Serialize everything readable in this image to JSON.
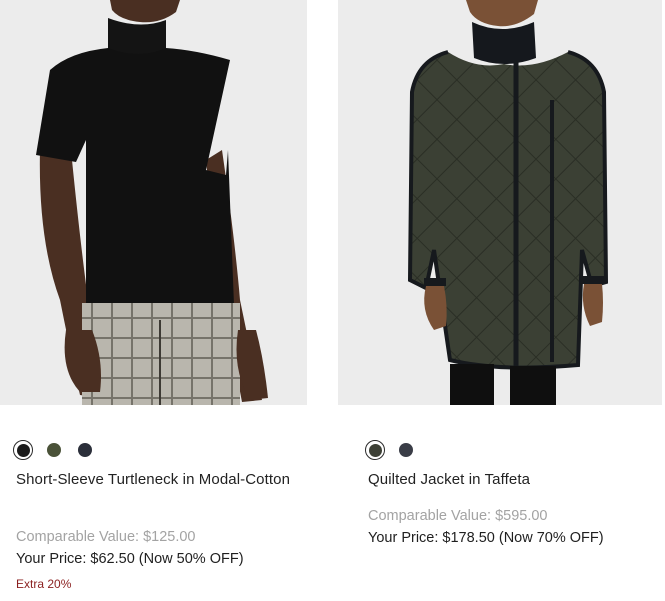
{
  "products": [
    {
      "name": "Short-Sleeve Turtleneck in Modal-Cotton",
      "comparable": "Comparable Value: $125.00",
      "price": "Your Price: $62.50 (Now 50% OFF)",
      "promo": "Extra 20%",
      "swatches": [
        {
          "name": "black",
          "color": "#1b1b1b",
          "selected": true
        },
        {
          "name": "olive",
          "color": "#4a5238",
          "selected": false
        },
        {
          "name": "navy",
          "color": "#2b2f3a",
          "selected": false
        }
      ]
    },
    {
      "name": "Quilted Jacket in Taffeta",
      "comparable": "Comparable Value: $595.00",
      "price": "Your Price: $178.50 (Now 70% OFF)",
      "swatches": [
        {
          "name": "dark-olive",
          "color": "#3c3f35",
          "selected": true
        },
        {
          "name": "navy",
          "color": "#3a3d47",
          "selected": false
        }
      ]
    }
  ]
}
